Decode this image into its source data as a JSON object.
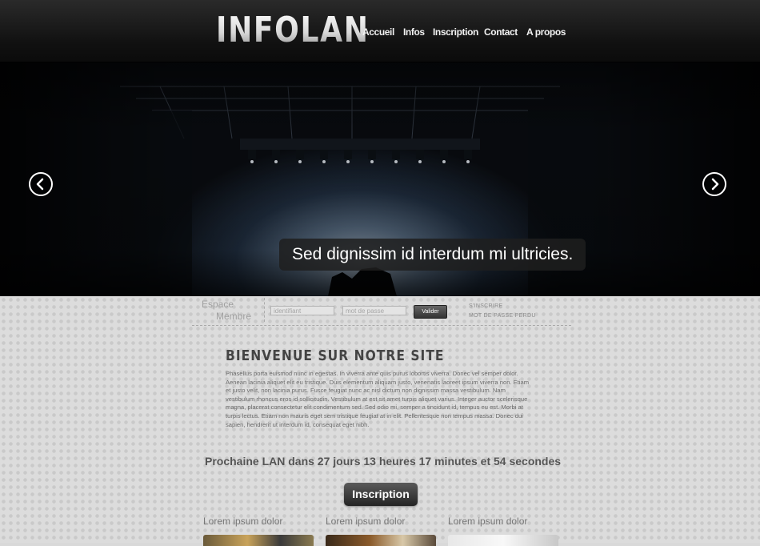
{
  "header": {
    "logo": "INFOLAN",
    "nav": [
      "Accueil",
      "Infos",
      "Inscription",
      "Contact",
      "A propos"
    ]
  },
  "hero": {
    "caption": "Sed dignissim id interdum mi ultricies."
  },
  "member": {
    "title_line1": "Espace",
    "title_line2": "Membre",
    "username_placeholder": "identifiant",
    "password_placeholder": "mot de passe",
    "submit_label": "Valider",
    "register_link": "s'inscrire",
    "forgot_link": "mot de passe perdu"
  },
  "welcome": {
    "title": "Bienvenue sur notre site",
    "body": "Phasellus porta euismod nunc in egestas. In viverra ante quis purus lobortis viverra. Donec vel semper dolor. Aenean lacinia aliquet elit eu tristique. Duis elementum aliquam justo, venenatis laoreet ipsum viverra non. Etiam et justo velit, non lacinia purus. Fusce feugiat nunc ac nisl dictum non dignissim massa vestibulum. Nam vestibulum rhoncus eros id sollicitudin. Vestibulum at est sit amet turpis aliquet varius. Integer auctor scelerisque magna, placerat consectetur elit condimentum sed. Sed odio mi, semper a tincidunt id, tempus eu est. Morbi at turpis lectus. Etiam non mauris eget sem tristique feugiat at in elit. Pellentesque non tempus massa. Donec dui sapien, hendrerit ut interdum id, consequat eget nibh."
  },
  "countdown": "Prochaine LAN dans 27 jours 13 heures 17 minutes et 54 secondes",
  "cta_label": "Inscription",
  "cards": [
    {
      "title": "Lorem ipsum dolor"
    },
    {
      "title": "Lorem ipsum dolor"
    },
    {
      "title": "Lorem ipsum dolor"
    }
  ],
  "colors": {
    "header_bg": "#111111",
    "content_bg": "#dcdcdc",
    "caption_bg": "#1e1e1e",
    "text_dark": "#444444"
  }
}
